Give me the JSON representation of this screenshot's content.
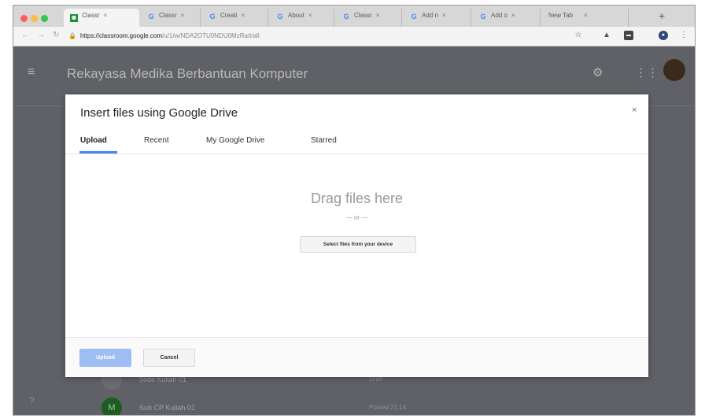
{
  "browser": {
    "tabs": [
      {
        "label": "Classr",
        "icon": "classroom-icon",
        "active": true
      },
      {
        "label": "Classr",
        "icon": "google-icon"
      },
      {
        "label": "Creati",
        "icon": "google-icon"
      },
      {
        "label": "About",
        "icon": "google-icon"
      },
      {
        "label": "Classr",
        "icon": "google-icon"
      },
      {
        "label": "Add n",
        "icon": "google-icon"
      },
      {
        "label": "Add o",
        "icon": "google-icon"
      },
      {
        "label": "New Tab"
      }
    ],
    "tab_close": "×",
    "new_tab": "+",
    "url_host": "https://classroom.google.com",
    "url_path": "/u/1/w/NDA2OTU0NDU0MzRa/t/all",
    "colors": {
      "close_dot": "#fc605c",
      "min_dot": "#fdbc40",
      "max_dot": "#34c84a"
    }
  },
  "app": {
    "title": "Rekayasa Medika Berbantuan Komputer",
    "bg_rows": [
      {
        "label": "Slide Kuliah 01",
        "meta": "Draft",
        "color": "#6a6c71"
      },
      {
        "label": "Sub CP Kuliah 01",
        "meta": "Posted 21:14",
        "color": "#1b5e20"
      }
    ]
  },
  "dialog": {
    "title": "Insert files using Google Drive",
    "close": "×",
    "tabs": [
      "Upload",
      "Recent",
      "My Google Drive",
      "Starred"
    ],
    "drag_text": "Drag files here",
    "or_text": "— or —",
    "select_button": "Select files from your device",
    "upload_button": "Upload",
    "cancel_button": "Cancel",
    "accent": "#4285f4"
  }
}
